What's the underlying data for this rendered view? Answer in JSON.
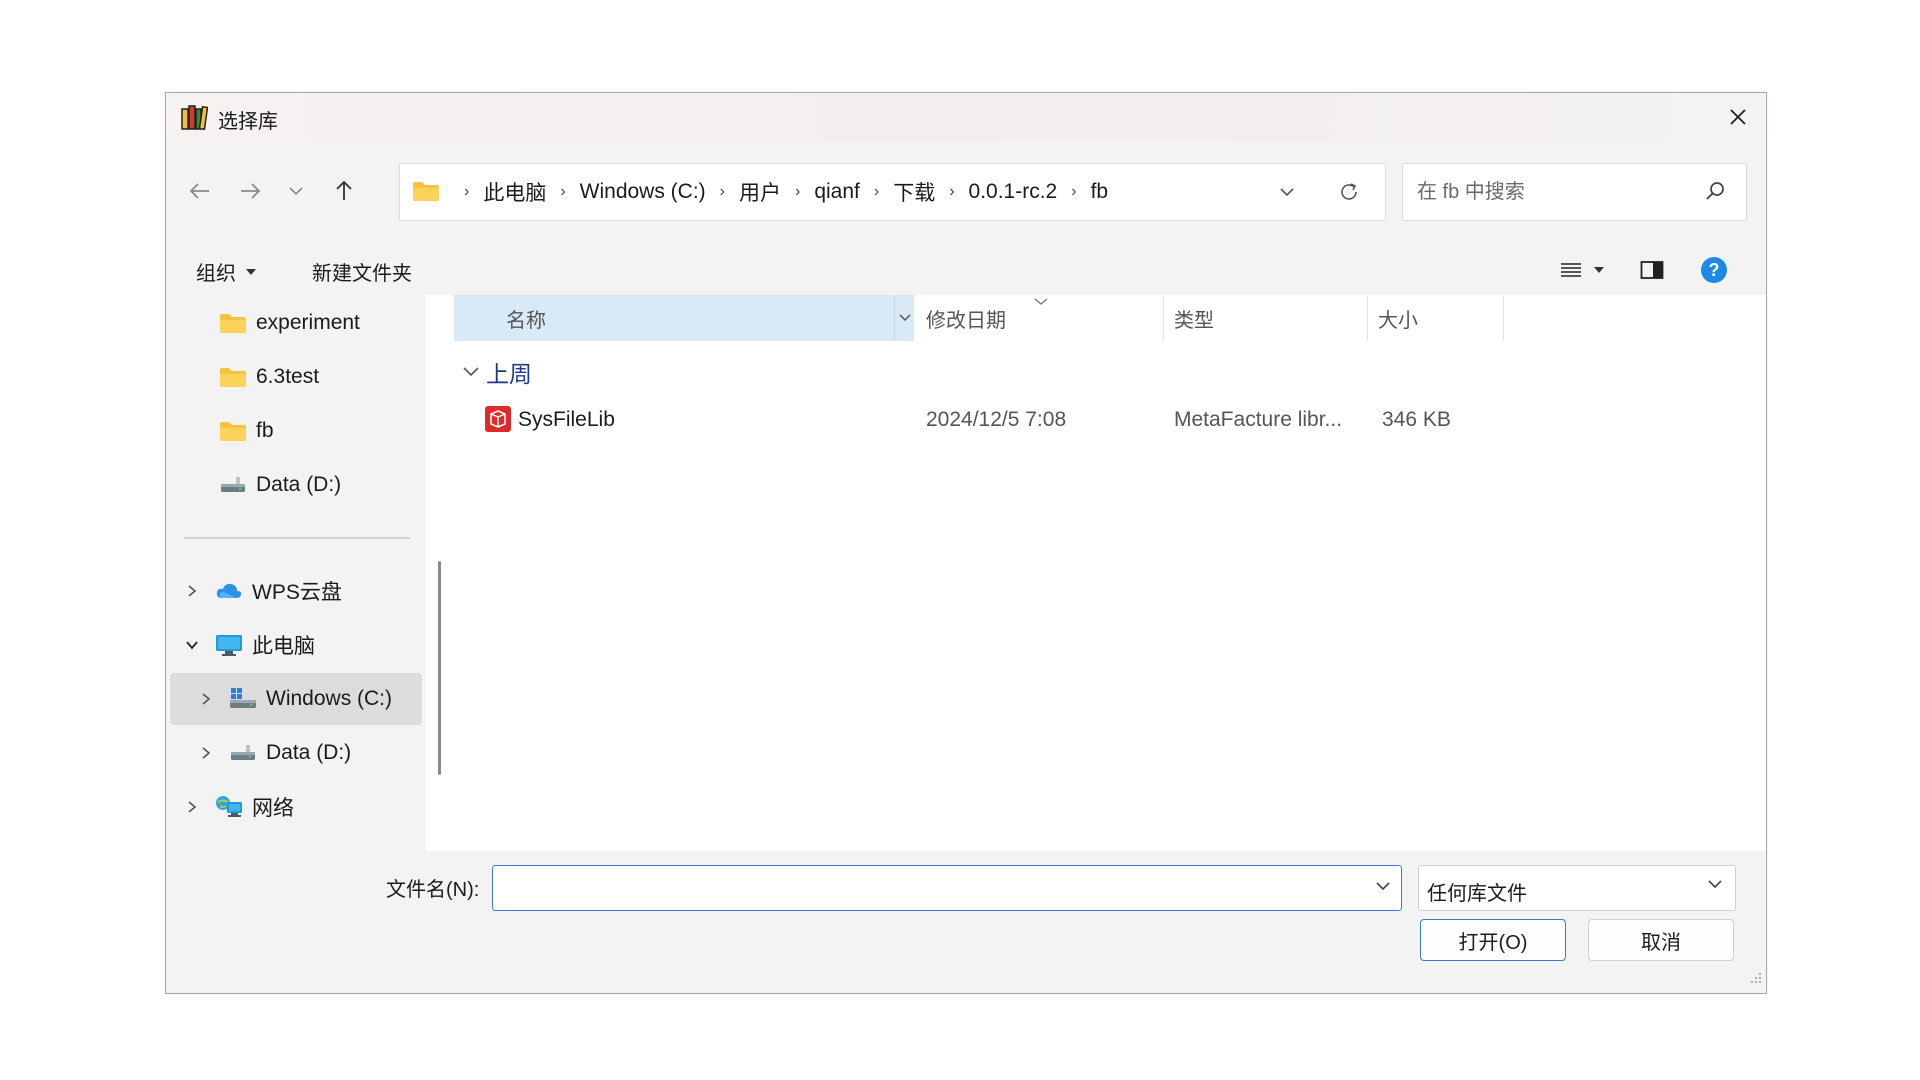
{
  "window": {
    "title": "选择库"
  },
  "address": {
    "crumbs": [
      "此电脑",
      "Windows (C:)",
      "用户",
      "qianf",
      "下载",
      "0.0.1-rc.2",
      "fb"
    ]
  },
  "search": {
    "placeholder": "在 fb 中搜索"
  },
  "toolbar": {
    "organize_label": "组织",
    "new_folder_label": "新建文件夹"
  },
  "sidebar": {
    "quick_items": [
      {
        "label": "experiment",
        "icon": "folder-icon"
      },
      {
        "label": "6.3test",
        "icon": "folder-icon"
      },
      {
        "label": "fb",
        "icon": "folder-icon"
      },
      {
        "label": "Data (D:)",
        "icon": "drive-icon"
      }
    ],
    "tree_items": [
      {
        "label": "WPS云盘",
        "icon": "cloud-icon",
        "expanded": false
      },
      {
        "label": "此电脑",
        "icon": "computer-icon",
        "expanded": true
      },
      {
        "label": "Windows (C:)",
        "icon": "windows-drive-icon",
        "expanded": false,
        "selected": true
      },
      {
        "label": "Data (D:)",
        "icon": "drive-icon",
        "expanded": false
      },
      {
        "label": "网络",
        "icon": "network-icon",
        "expanded": false
      }
    ]
  },
  "columns": {
    "name": "名称",
    "date": "修改日期",
    "type": "类型",
    "size": "大小"
  },
  "group": {
    "label": "上周"
  },
  "files": [
    {
      "name": "SysFileLib",
      "date": "2024/12/5 7:08",
      "type": "MetaFacture libr...",
      "size": "346 KB",
      "icon": "library-file-icon"
    }
  ],
  "footer": {
    "filename_label": "文件名(N):",
    "filename_value": "",
    "filter_value": "任何库文件",
    "open_label": "打开(O)",
    "cancel_label": "取消"
  },
  "colors": {
    "accent": "#3a7bd5",
    "header_highlight": "#d9eaf6",
    "group_text": "#1f3a8a",
    "help": "#1e88e5"
  }
}
